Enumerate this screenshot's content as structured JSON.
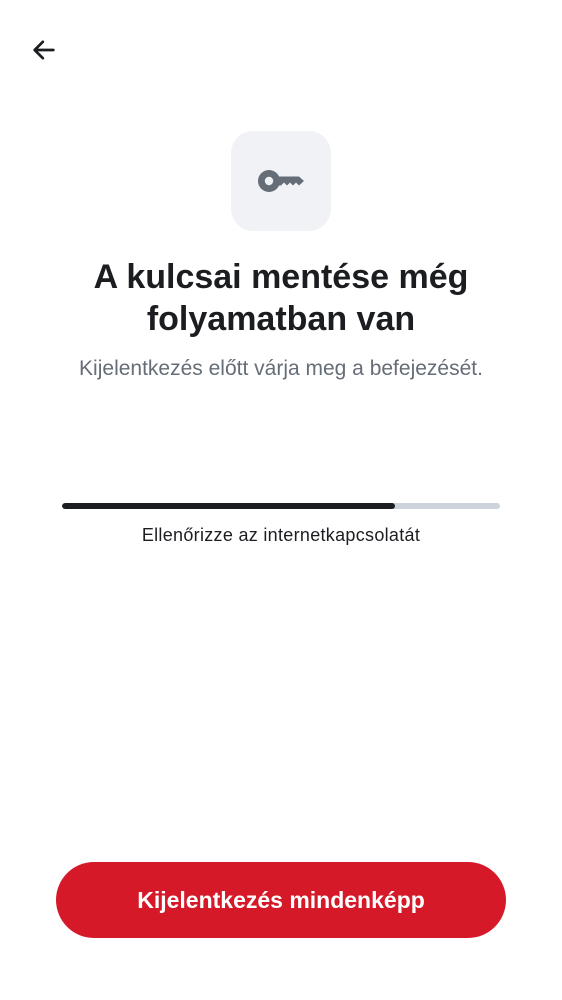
{
  "header": {
    "back_icon": "arrow-left-icon"
  },
  "hero": {
    "icon": "key-icon",
    "title": "A kulcsai mentése még folyamatban van",
    "subtitle": "Kijelentkezés előtt várja meg a befejezését."
  },
  "progress": {
    "value_fraction": 0.76,
    "status_text": "Ellenőrizze az internetkapcsolatát"
  },
  "footer": {
    "signout_label": "Kijelentkezés mindenképp"
  },
  "colors": {
    "accent": "#d51928",
    "text_primary": "#1b1d21",
    "text_secondary": "#656d77",
    "icon_tile_bg": "#f0f2f5",
    "progress_track": "#cdd3da"
  }
}
